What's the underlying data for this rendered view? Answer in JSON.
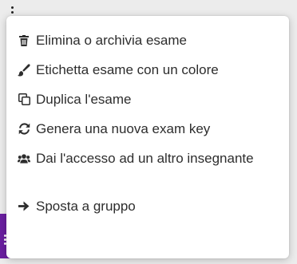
{
  "menu": {
    "items": [
      {
        "label": "Elimina o archivia esame",
        "icon": "trash-icon"
      },
      {
        "label": "Etichetta esame con un colore",
        "icon": "paint-brush-icon"
      },
      {
        "label": "Duplica l'esame",
        "icon": "copy-icon"
      },
      {
        "label": "Genera una nuova exam key",
        "icon": "refresh-icon"
      },
      {
        "label": "Dai l'accesso ad un altro insegnante",
        "icon": "users-icon"
      },
      {
        "label": "Sposta a gruppo",
        "icon": "arrow-right-icon"
      }
    ]
  },
  "colors": {
    "text": "#2d2d2d",
    "menu_background": "#ffffff",
    "page_background": "#ececec",
    "accent_purple": "#6a1fa0"
  }
}
